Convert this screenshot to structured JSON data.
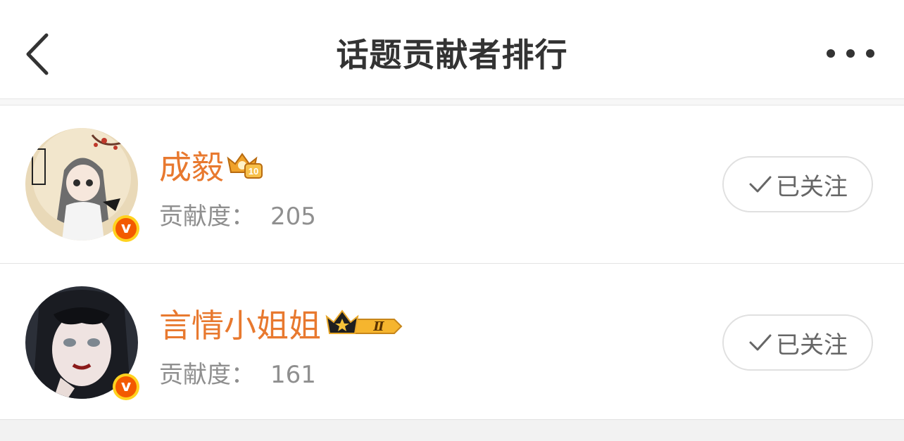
{
  "header": {
    "title": "话题贡献者排行",
    "back_icon": "chevron-left-icon",
    "more_icon": "more-dots-icon"
  },
  "contributors": [
    {
      "name": "成毅",
      "contribution_label": "贡献度：",
      "contribution_value": "205",
      "follow_label": "已关注",
      "badge_icon": "crown-level-badge-icon",
      "badge_text": "10",
      "verified_icon": "verified-v-icon"
    },
    {
      "name": "言情小姐姐",
      "contribution_label": "贡献度：",
      "contribution_value": "161",
      "follow_label": "已关注",
      "badge_icon": "crown-level-badge-icon",
      "badge_text": "Ⅱ",
      "verified_icon": "verified-v-icon"
    }
  ],
  "colors": {
    "name": "#e8792f",
    "secondary_text": "#8f8f8f",
    "verified_badge": "#f35a00"
  }
}
